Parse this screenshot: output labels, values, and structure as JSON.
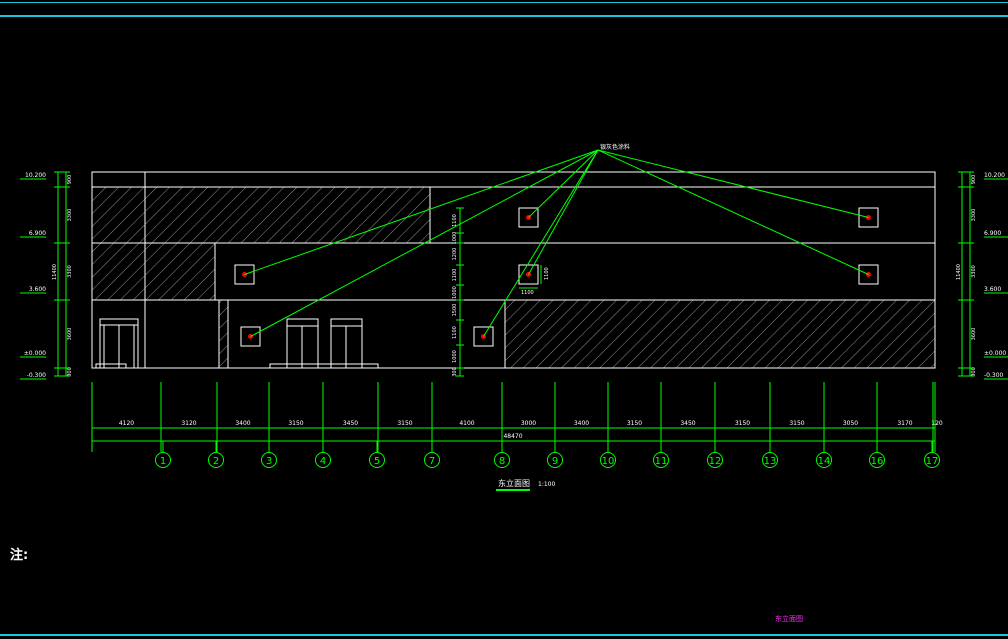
{
  "drawing": {
    "title": "东立面图",
    "scale": "1:100",
    "note_label": "注:",
    "sheet_label": "东立面图",
    "material_callout": "银灰色涂料",
    "total_length": "48470",
    "dimensions": [
      "4120",
      "3120",
      "3400",
      "3150",
      "3450",
      "3150",
      "4100",
      "3000",
      "3400",
      "3150",
      "3450",
      "3150",
      "3150",
      "3050",
      "3170",
      "120"
    ],
    "axes": [
      "1",
      "2",
      "3",
      "4",
      "5",
      "7",
      "8",
      "9",
      "10",
      "11",
      "12",
      "13",
      "14",
      "16",
      "17"
    ],
    "level_marks": [
      "10.200",
      "6.900",
      "3.600",
      "±0.000",
      "-0.300"
    ],
    "vertical_dims_outer": [
      "900",
      "3300",
      "3300",
      "3600",
      "300"
    ],
    "vertical_total": "11400",
    "vertical_dims_mid": [
      "1100",
      "1000",
      "1200",
      "1100",
      "1000",
      "1500",
      "1100",
      "1000",
      "300"
    ],
    "window_size": "1100"
  },
  "colors": {
    "line": "#ffffff",
    "dim": "#00ff00",
    "frame": "#18c8d8",
    "marker": "#ff0000",
    "sheet": "#ff30ff"
  }
}
